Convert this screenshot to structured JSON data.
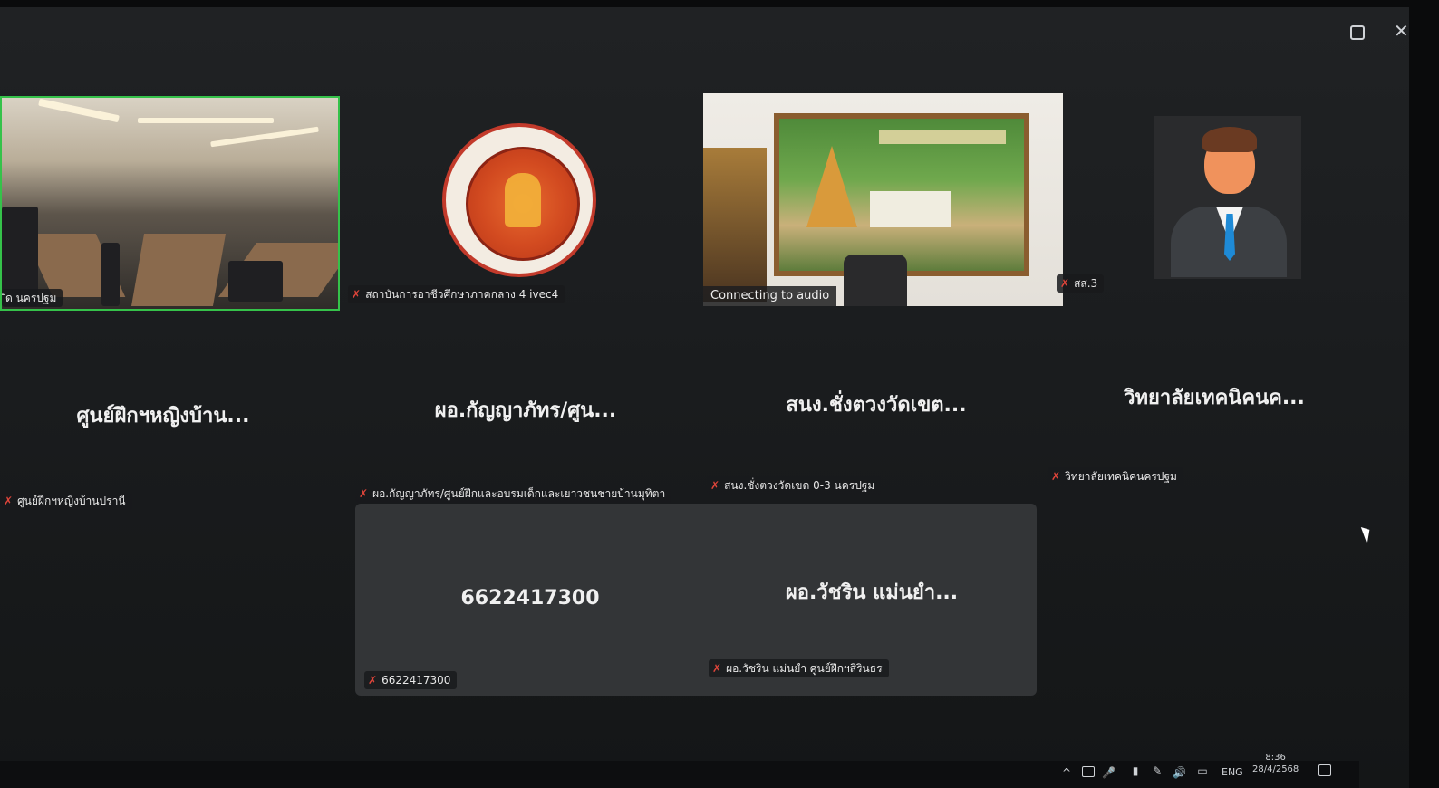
{
  "window": {
    "restore_glyph": "▢",
    "close_glyph": "✕"
  },
  "participants": [
    {
      "label": "ัด นครปฐม",
      "big_name": "ศูนย์ฝึกฯหญิงบ้าน...",
      "bar_label": "ศูนย์ฝึกฯหญิงบ้านปรานี"
    },
    {
      "label": "สถาบันการอาชีวศึกษาภาคกลาง 4 ivec4",
      "big_name": "ผอ.กัญญาภัทร/ศูน...",
      "bar_label": "ผอ.กัญญาภัทร/ศูนย์ฝึกและอบรมเด็กและเยาวชนชายบ้านมุทิตา"
    },
    {
      "status": "Connecting to audio",
      "big_name": "สนง.ชั่งตวงวัดเขต...",
      "bar_label": "สนง.ชั่งตวงวัดเขต 0-3 นครปฐม"
    },
    {
      "label": "สส.3",
      "big_name": "วิทยาลัยเทคนิคนค...",
      "bar_label": "วิทยาลัยเทคนิคนครปฐม"
    },
    {
      "big_name": "6622417300",
      "bar_label": "6622417300"
    },
    {
      "big_name": "ผอ.วัชริน แม่นยำ...",
      "bar_label": "ผอ.วัชริน แม่นยำ ศูนย์ฝึกฯสิรินธร"
    }
  ],
  "taskbar": {
    "tray": {
      "chevron": "^",
      "language": "ENG",
      "volume_glyph": "🔊",
      "mic_glyph": "🎤"
    },
    "time": "8:36",
    "date": "28/4/2568"
  },
  "icons": {
    "mic_muted": "✗"
  }
}
